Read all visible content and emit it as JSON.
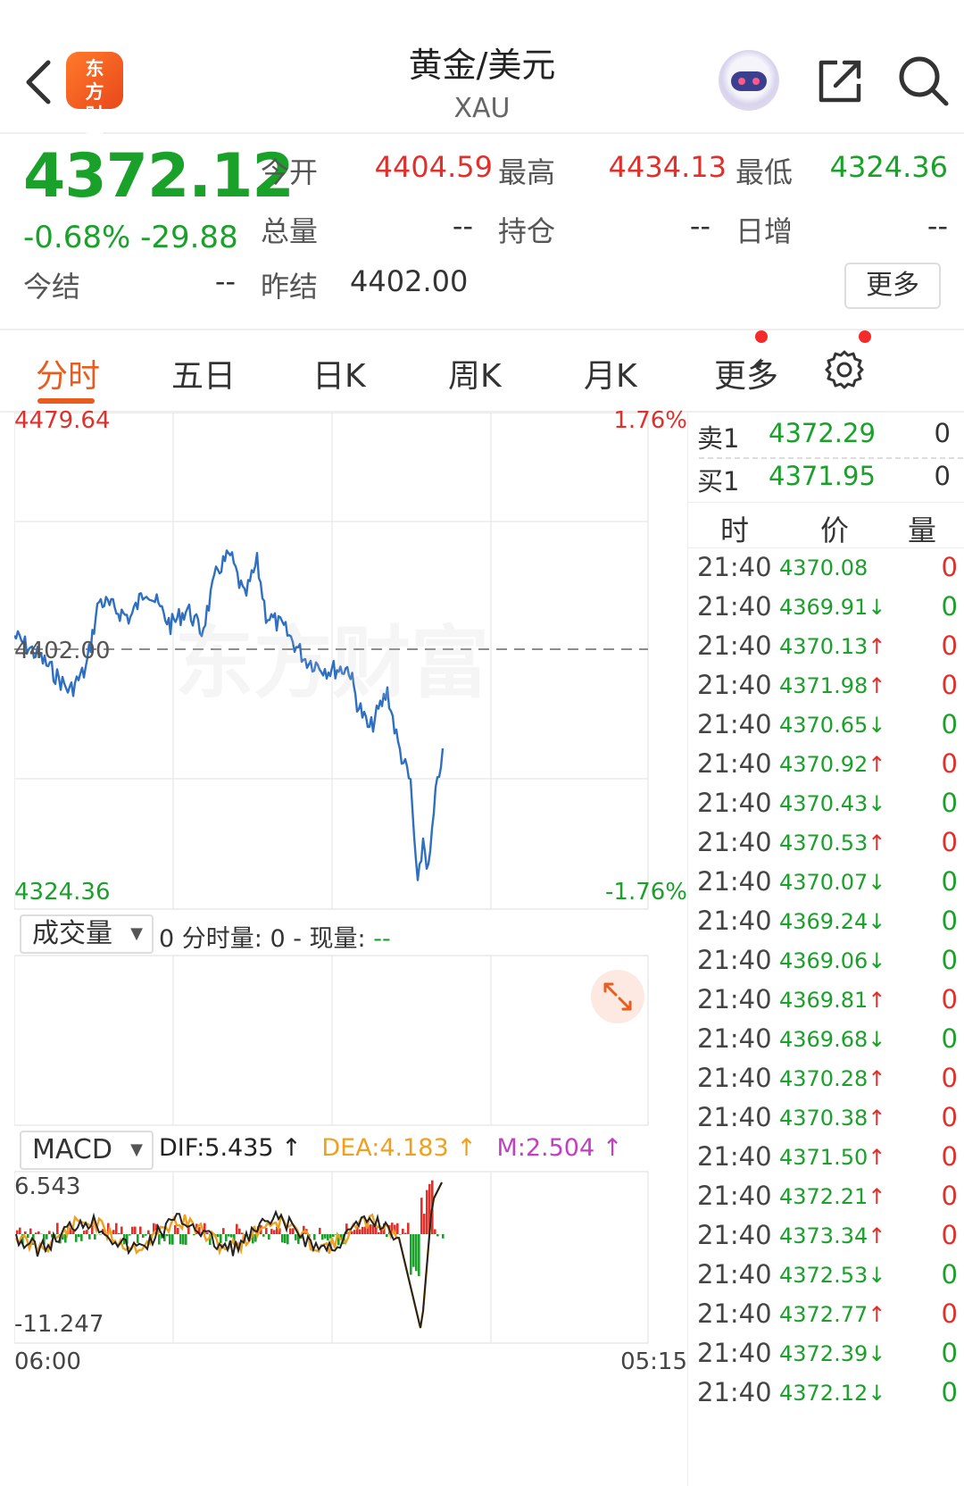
{
  "header": {
    "logo_text": "东方财富",
    "title": "黄金/美元",
    "subtitle": "XAU"
  },
  "quote": {
    "price": "4372.12",
    "change_pct": "-0.68%",
    "change_abs": "-29.88",
    "fields": [
      {
        "label": "今开",
        "value": "4404.59",
        "tone": "red"
      },
      {
        "label": "最高",
        "value": "4434.13",
        "tone": "red"
      },
      {
        "label": "最低",
        "value": "4324.36",
        "tone": "green"
      },
      {
        "label": "总量",
        "value": "--",
        "tone": "dark"
      },
      {
        "label": "持仓",
        "value": "--",
        "tone": "dark"
      },
      {
        "label": "日增",
        "value": "--",
        "tone": "dark"
      },
      {
        "label": "今结",
        "value": "--",
        "tone": "dark"
      },
      {
        "label": "昨结",
        "value": "4402.00",
        "tone": "dark"
      }
    ],
    "more_label": "更多"
  },
  "tabs": [
    {
      "label": "分时",
      "active": true
    },
    {
      "label": "五日"
    },
    {
      "label": "日K"
    },
    {
      "label": "周K"
    },
    {
      "label": "月K"
    },
    {
      "label": "更多"
    }
  ],
  "chart": {
    "watermark": "东方财富",
    "price_high": "4479.64",
    "price_low": "4324.36",
    "pct_high": "1.76%",
    "pct_low": "-1.76%",
    "prev_close_label": "4402.00",
    "volume_selector": "成交量",
    "volume_info_prefix": "0 分时量: 0 - 现量:",
    "volume_info_suffix": "--",
    "macd_selector": "MACD",
    "dif": "DIF:5.435 ↑",
    "dea": "DEA:4.183 ↑",
    "m": "M:2.504 ↑",
    "macd_high": "6.543",
    "macd_low": "-11.247",
    "time_start": "06:00",
    "time_end": "05:15",
    "colors": {
      "line": "#2f6fc0",
      "up": "#e0302c",
      "down": "#1aa12a",
      "dif": "#222222",
      "dea": "#f0a020",
      "m": "#c040c0"
    }
  },
  "orderbook": [
    {
      "label": "卖1",
      "price": "4372.29",
      "qty": "0"
    },
    {
      "label": "买1",
      "price": "4371.95",
      "qty": "0"
    }
  ],
  "ticks_header": {
    "time": "时",
    "price": "价",
    "qty": "量"
  },
  "ticks": [
    {
      "time": "21:40",
      "price": "4370.08",
      "arrow": "",
      "qty": "0",
      "qtone": "red"
    },
    {
      "time": "21:40",
      "price": "4369.91",
      "arrow": "↓",
      "qty": "0",
      "qtone": "green"
    },
    {
      "time": "21:40",
      "price": "4370.13",
      "arrow": "↑",
      "qty": "0",
      "qtone": "red"
    },
    {
      "time": "21:40",
      "price": "4371.98",
      "arrow": "↑",
      "qty": "0",
      "qtone": "red"
    },
    {
      "time": "21:40",
      "price": "4370.65",
      "arrow": "↓",
      "qty": "0",
      "qtone": "green"
    },
    {
      "time": "21:40",
      "price": "4370.92",
      "arrow": "↑",
      "qty": "0",
      "qtone": "red"
    },
    {
      "time": "21:40",
      "price": "4370.43",
      "arrow": "↓",
      "qty": "0",
      "qtone": "green"
    },
    {
      "time": "21:40",
      "price": "4370.53",
      "arrow": "↑",
      "qty": "0",
      "qtone": "red"
    },
    {
      "time": "21:40",
      "price": "4370.07",
      "arrow": "↓",
      "qty": "0",
      "qtone": "green"
    },
    {
      "time": "21:40",
      "price": "4369.24",
      "arrow": "↓",
      "qty": "0",
      "qtone": "green"
    },
    {
      "time": "21:40",
      "price": "4369.06",
      "arrow": "↓",
      "qty": "0",
      "qtone": "green"
    },
    {
      "time": "21:40",
      "price": "4369.81",
      "arrow": "↑",
      "qty": "0",
      "qtone": "red"
    },
    {
      "time": "21:40",
      "price": "4369.68",
      "arrow": "↓",
      "qty": "0",
      "qtone": "green"
    },
    {
      "time": "21:40",
      "price": "4370.28",
      "arrow": "↑",
      "qty": "0",
      "qtone": "red"
    },
    {
      "time": "21:40",
      "price": "4370.38",
      "arrow": "↑",
      "qty": "0",
      "qtone": "red"
    },
    {
      "time": "21:40",
      "price": "4371.50",
      "arrow": "↑",
      "qty": "0",
      "qtone": "red"
    },
    {
      "time": "21:40",
      "price": "4372.21",
      "arrow": "↑",
      "qty": "0",
      "qtone": "red"
    },
    {
      "time": "21:40",
      "price": "4373.34",
      "arrow": "↑",
      "qty": "0",
      "qtone": "red"
    },
    {
      "time": "21:40",
      "price": "4372.53",
      "arrow": "↓",
      "qty": "0",
      "qtone": "green"
    },
    {
      "time": "21:40",
      "price": "4372.77",
      "arrow": "↑",
      "qty": "0",
      "qtone": "red"
    },
    {
      "time": "21:40",
      "price": "4372.39",
      "arrow": "↓",
      "qty": "0",
      "qtone": "green"
    },
    {
      "time": "21:40",
      "price": "4372.12",
      "arrow": "↓",
      "qty": "0",
      "qtone": "green"
    }
  ]
}
